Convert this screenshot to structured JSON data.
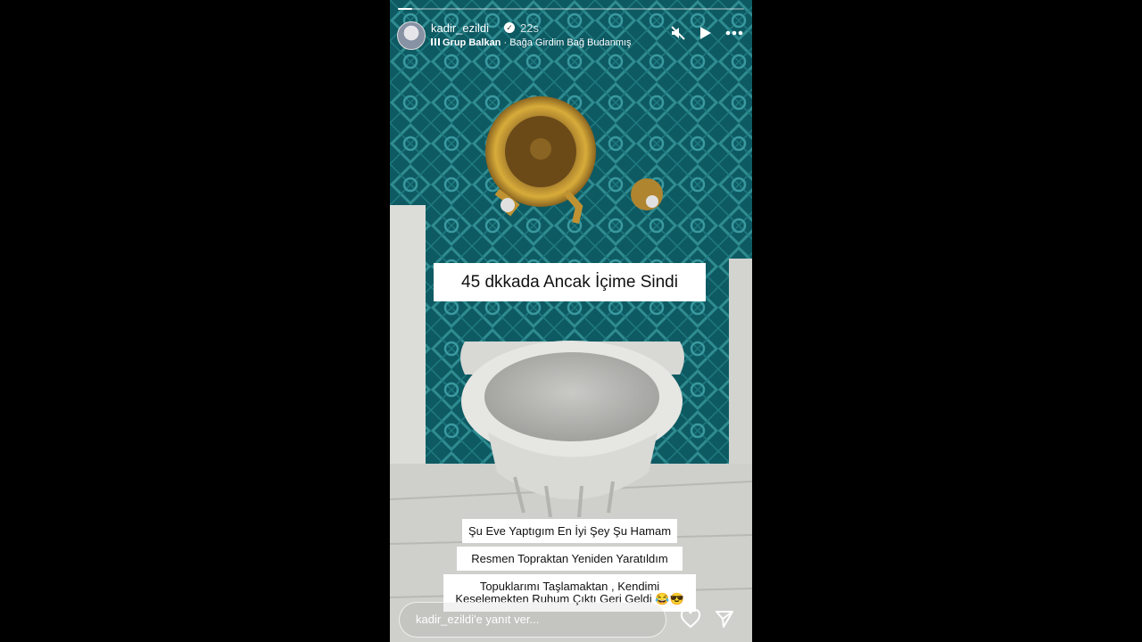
{
  "story": {
    "progress": 0.04,
    "user": {
      "username": "kadir_ezildi",
      "time": "22s"
    },
    "music": {
      "artist": "Grup Balkan",
      "song": "Bağa Girdim Bağ Budanmış"
    },
    "captions": {
      "main": "45 dkkada Ancak İçime Sindi",
      "line1": "Şu Eve Yaptıgım En İyi Şey Şu Hamam",
      "line2": "Resmen Topraktan Yeniden Yaratıldım",
      "line3a": "Topuklarımı Taşlamaktan , Kendimi",
      "line3b": "Keselemekten Ruhum Çıktı Geri Geldi 😂😎"
    },
    "reply": {
      "placeholder": "kadir_ezildi'e yanıt ver..."
    },
    "icons": [
      "mute-icon",
      "play-icon",
      "more-icon",
      "heart-icon",
      "share-icon"
    ]
  }
}
